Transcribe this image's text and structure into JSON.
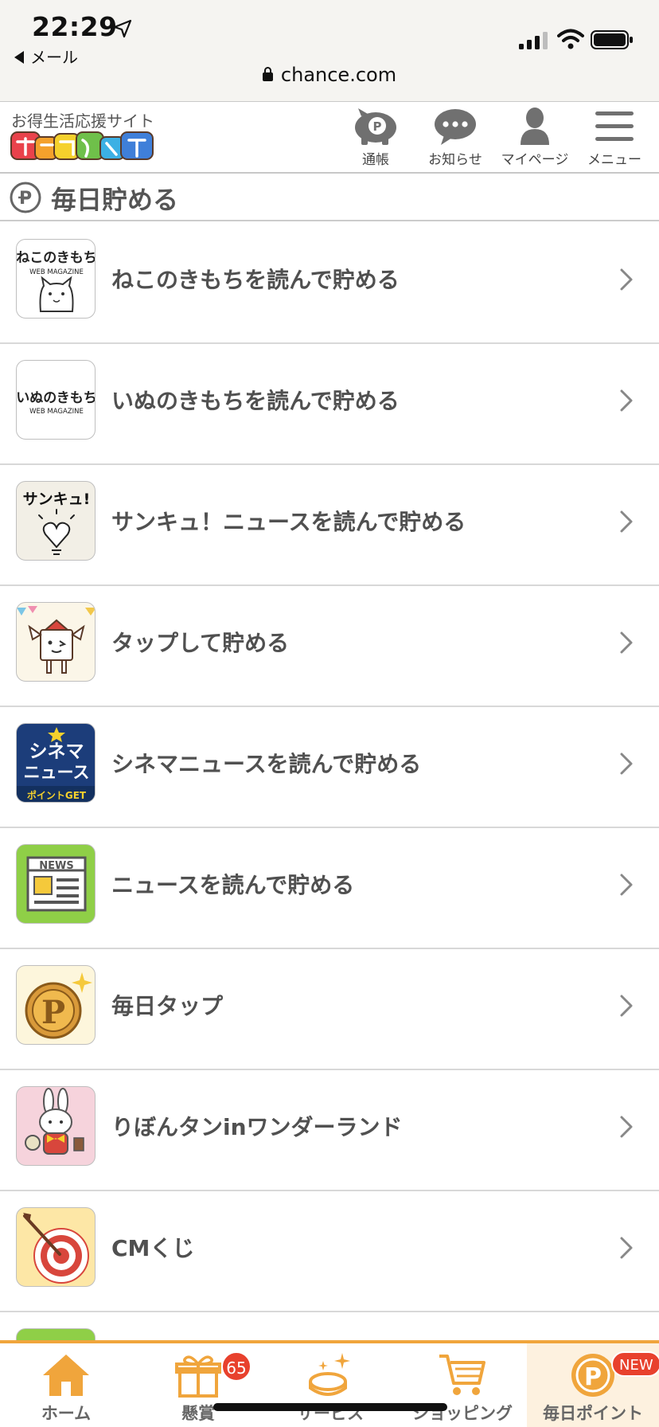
{
  "status_bar": {
    "time": "22:29",
    "back_app": "メール",
    "url": "chance.com"
  },
  "header": {
    "tagline": "お得生活応援サイト",
    "logo_text": "チャンスイット",
    "buttons": [
      {
        "label": "通帳",
        "icon": "piggy-bank-icon"
      },
      {
        "label": "お知らせ",
        "icon": "chat-bubble-icon"
      },
      {
        "label": "マイページ",
        "icon": "user-icon"
      },
      {
        "label": "メニュー",
        "icon": "hamburger-icon"
      }
    ]
  },
  "section": {
    "title": "毎日貯める",
    "icon": "point-coin-icon"
  },
  "items": [
    {
      "label": "ねこのきもちを読んで貯める",
      "thumb_title": "ねこのきもち",
      "thumb_sub": "WEB MAGAZINE"
    },
    {
      "label": "いぬのきもちを読んで貯める",
      "thumb_title": "いぬのきもち",
      "thumb_sub": "WEB MAGAZINE"
    },
    {
      "label": "サンキュ！ニュースを読んで貯める",
      "thumb_title": "サンキュ!"
    },
    {
      "label": "タップして貯める"
    },
    {
      "label": "シネマニュースを読んで貯める",
      "thumb_title_1": "シネマ",
      "thumb_title_2": "ニュース",
      "thumb_sub": "ポイントGET"
    },
    {
      "label": "ニュースを読んで貯める",
      "thumb_title": "NEWS"
    },
    {
      "label": "毎日タップ"
    },
    {
      "label": "りぼんタンinワンダーランド"
    },
    {
      "label": "CMくじ"
    }
  ],
  "tabbar": {
    "tabs": [
      {
        "label": "ホーム",
        "icon": "home-icon"
      },
      {
        "label": "懸賞",
        "icon": "gift-box-icon"
      },
      {
        "label": "サービス",
        "icon": "coin-sparkle-icon"
      },
      {
        "label": "ショッピング",
        "icon": "cart-icon"
      },
      {
        "label": "毎日ポイント",
        "icon": "point-coin-icon"
      }
    ],
    "prize_badge_count": "65",
    "new_badge": "NEW"
  },
  "colors": {
    "accent": "#f0a53c",
    "badge": "#e8412d",
    "active_tab_bg": "#fdf1df"
  }
}
